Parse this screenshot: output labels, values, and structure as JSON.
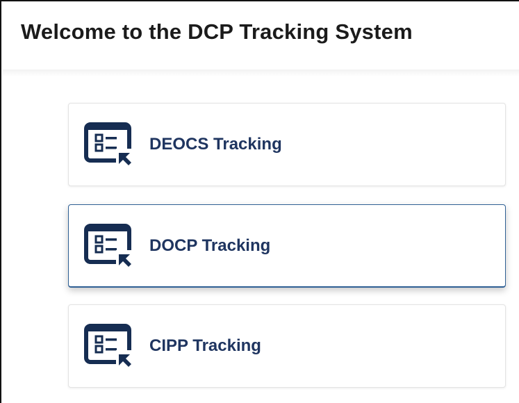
{
  "header": {
    "title": "Welcome to the DCP Tracking System"
  },
  "cards": [
    {
      "label": "DEOCS Tracking",
      "icon": "tracking-form-cursor-icon",
      "active": false
    },
    {
      "label": "DOCP Tracking",
      "icon": "tracking-form-cursor-icon",
      "active": true
    },
    {
      "label": "CIPP Tracking",
      "icon": "tracking-form-cursor-icon",
      "active": false
    }
  ],
  "colors": {
    "title_text": "#1b1b1b",
    "card_label": "#1f3560",
    "icon_navy": "#162d52",
    "active_border": "#2e5f94"
  }
}
